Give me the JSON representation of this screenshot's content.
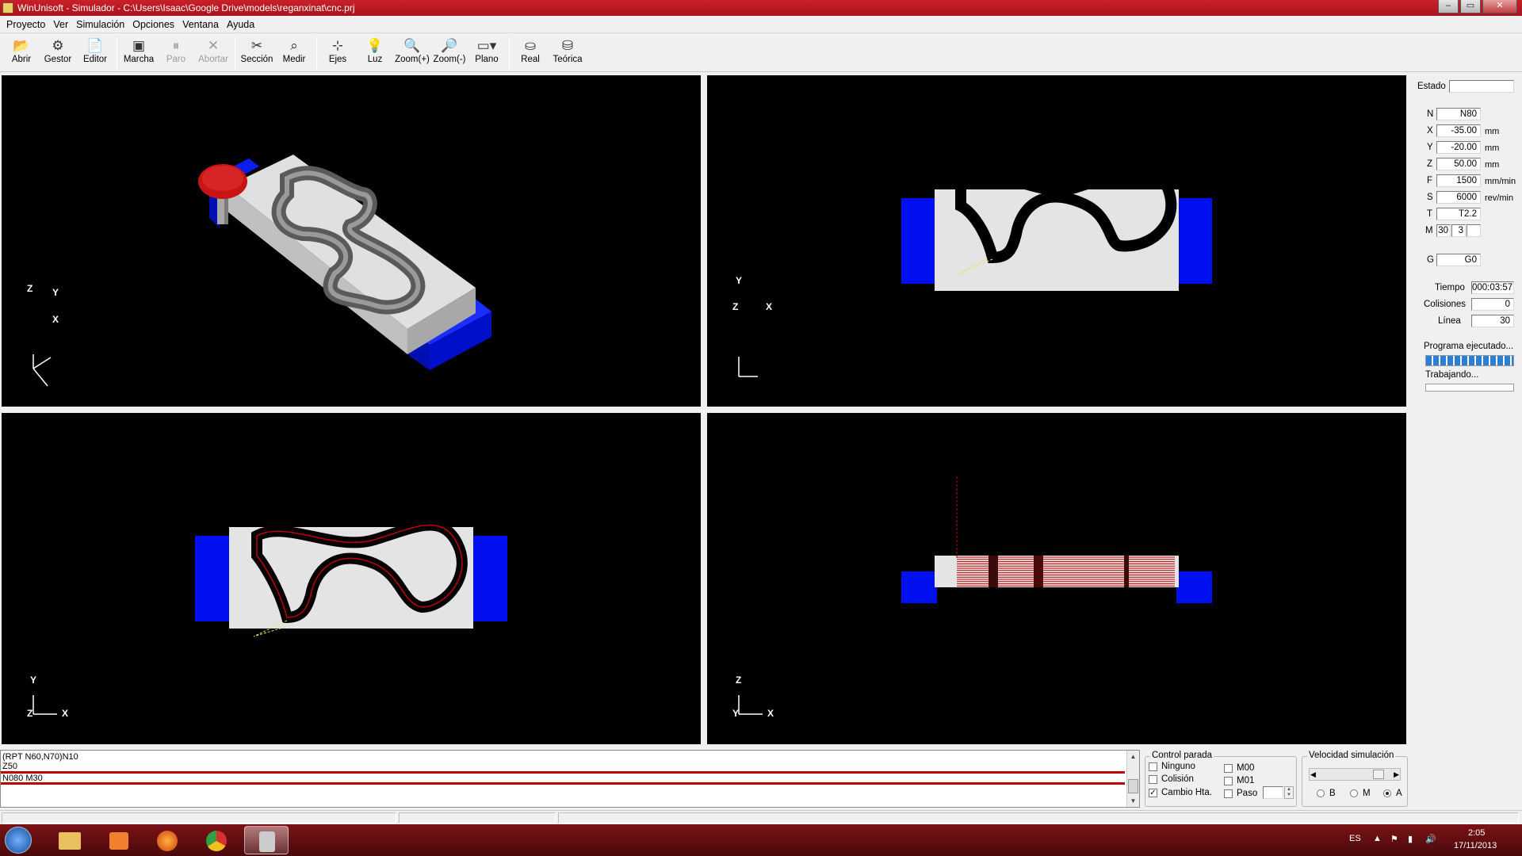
{
  "window": {
    "title": "WinUnisoft - Simulador - C:\\Users\\Isaac\\Google Drive\\models\\reganxinat\\cnc.prj",
    "buttons": [
      "‒",
      "▭",
      "✕"
    ]
  },
  "menu": [
    "Proyecto",
    "Ver",
    "Simulación",
    "Opciones",
    "Ventana",
    "Ayuda"
  ],
  "toolbar": {
    "abrir": "Abrir",
    "gestor": "Gestor",
    "editor": "Editor",
    "marcha": "Marcha",
    "paro": "Paro",
    "abortar": "Abortar",
    "seccion": "Sección",
    "medir": "Medir",
    "ejes": "Ejes",
    "luz": "Luz",
    "zoom_in": "Zoom(+)",
    "zoom_out": "Zoom(-)",
    "plano": "Plano",
    "real": "Real",
    "teorica": "Teórica"
  },
  "viewports": {
    "iso": {
      "axis_labels": [
        "Z",
        "Y",
        "X"
      ]
    },
    "top_right": {
      "axis_labels": [
        "Y",
        "Z",
        "X"
      ]
    },
    "bottom_left": {
      "axis_labels": [
        "Y",
        "Z",
        "X"
      ]
    },
    "bottom_right": {
      "axis_labels": [
        "Z",
        "Y",
        "X"
      ]
    }
  },
  "panel": {
    "estado_label": "Estado",
    "estado_value": "",
    "N_label": "N",
    "N_value": "N80",
    "X_label": "X",
    "X_value": "-35.00",
    "X_unit": "mm",
    "Y_label": "Y",
    "Y_value": "-20.00",
    "Y_unit": "mm",
    "Z_label": "Z",
    "Z_value": "50.00",
    "Z_unit": "mm",
    "F_label": "F",
    "F_value": "1500",
    "F_unit": "mm/min",
    "S_label": "S",
    "S_value": "6000",
    "S_unit": "rev/min",
    "T_label": "T",
    "T_value": "T2.2",
    "M_label": "M",
    "M_value1": "30",
    "M_value2": "3",
    "M_value3": "",
    "G_label": "G",
    "G_value": "G0",
    "tiempo_label": "Tiempo",
    "tiempo_value": "000:03:57",
    "colisiones_label": "Colisiones",
    "colisiones_value": "0",
    "linea_label": "Línea",
    "linea_value": "30",
    "programa_label": "Programa ejecutado...",
    "programa_progress": 1.0,
    "trabajando_label": "Trabajando...",
    "trabajando_progress": 0.0
  },
  "code": [
    "(RPT N60,N70)N10",
    "Z50",
    "N080 M30"
  ],
  "control_parada": {
    "title": "Control parada",
    "options": [
      {
        "label": "Ninguno",
        "checked": false
      },
      {
        "label": "Colisión",
        "checked": false
      },
      {
        "label": "Cambio Hta.",
        "checked": true
      },
      {
        "label": "M00",
        "checked": false
      },
      {
        "label": "M01",
        "checked": false
      },
      {
        "label": "Paso",
        "checked": false
      }
    ],
    "paso_value": ""
  },
  "velocidad": {
    "title": "Velocidad simulación",
    "radios": [
      {
        "label": "B",
        "selected": false
      },
      {
        "label": "M",
        "selected": false
      },
      {
        "label": "A",
        "selected": true
      }
    ],
    "slider_level": 0.92
  },
  "taskbar": {
    "lang": "ES",
    "time": "2:05",
    "date": "17/11/2013"
  },
  "colors": {
    "titlebar": "#b0161f",
    "stock": "#e4e4e4",
    "clamp": "#0011ee",
    "tool_head": "#c81414",
    "path_yellow": "#e8e070",
    "path_red": "#c00000"
  }
}
